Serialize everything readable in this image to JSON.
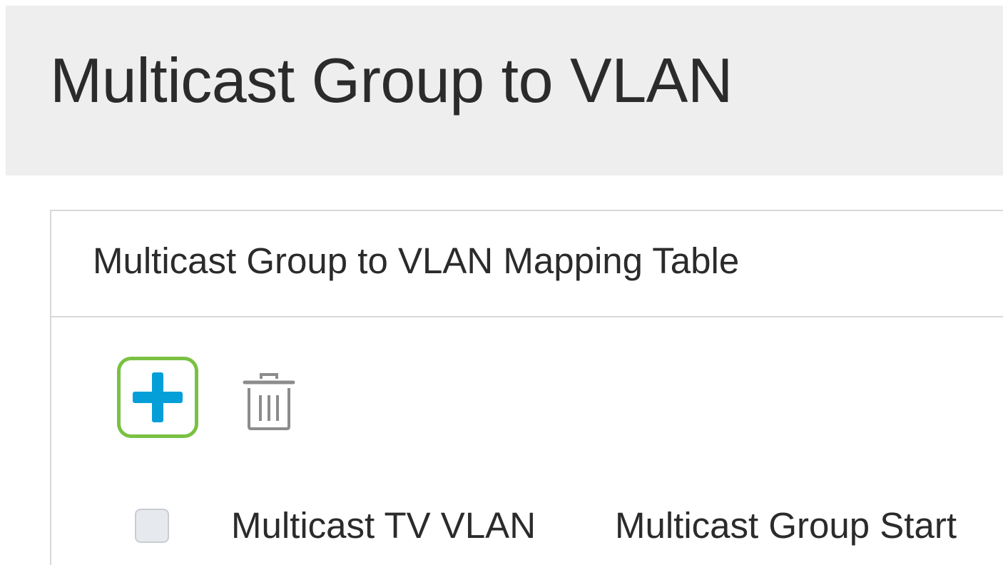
{
  "page": {
    "title": "Multicast Group to VLAN"
  },
  "panel": {
    "title": "Multicast Group to VLAN Mapping Table"
  },
  "toolbar": {
    "add_icon": "plus-icon",
    "delete_icon": "trash-icon"
  },
  "table": {
    "columns": [
      "Multicast TV VLAN",
      "Multicast Group Start"
    ]
  },
  "colors": {
    "accent": "#049fd9",
    "highlight": "#7ac143",
    "header_bg": "#eeeeee"
  }
}
